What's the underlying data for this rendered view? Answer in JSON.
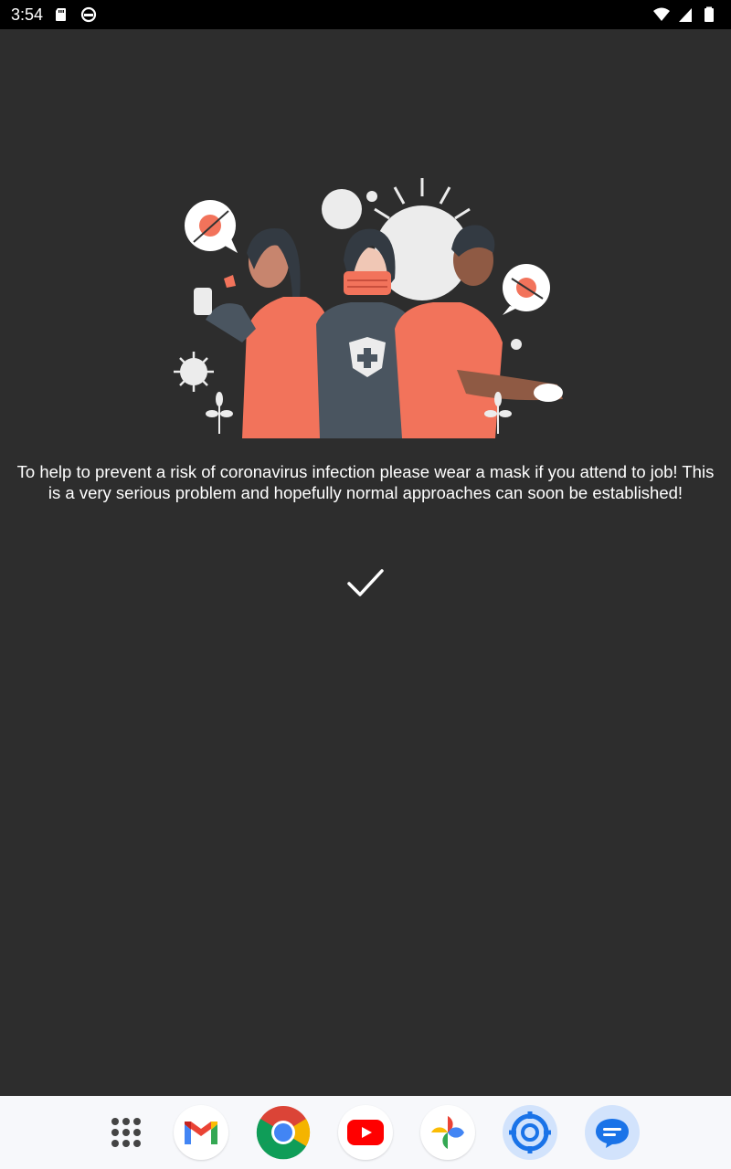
{
  "status_bar": {
    "time": "3:54",
    "left_icons": [
      "sd-card-icon",
      "sync-icon"
    ],
    "right_icons": [
      "wifi-icon",
      "signal-icon",
      "battery-icon"
    ]
  },
  "content": {
    "illustration": "people-wearing-masks-illustration",
    "message_line1": "To help to prevent a risk of coronavirus infection please wear a mask if you attend to job! This",
    "message_line2": "is a very serious problem and hopefully normal approaches can soon be established!",
    "confirm_icon": "checkmark-icon"
  },
  "dock": {
    "apps": [
      "app-drawer-icon",
      "gmail-icon",
      "chrome-icon",
      "youtube-icon",
      "photos-icon",
      "target-app-icon",
      "messages-icon"
    ]
  },
  "colors": {
    "background": "#2d2d2d",
    "status_bar": "#000000",
    "dock": "#f7f8fb",
    "accent": "#f2735b"
  }
}
